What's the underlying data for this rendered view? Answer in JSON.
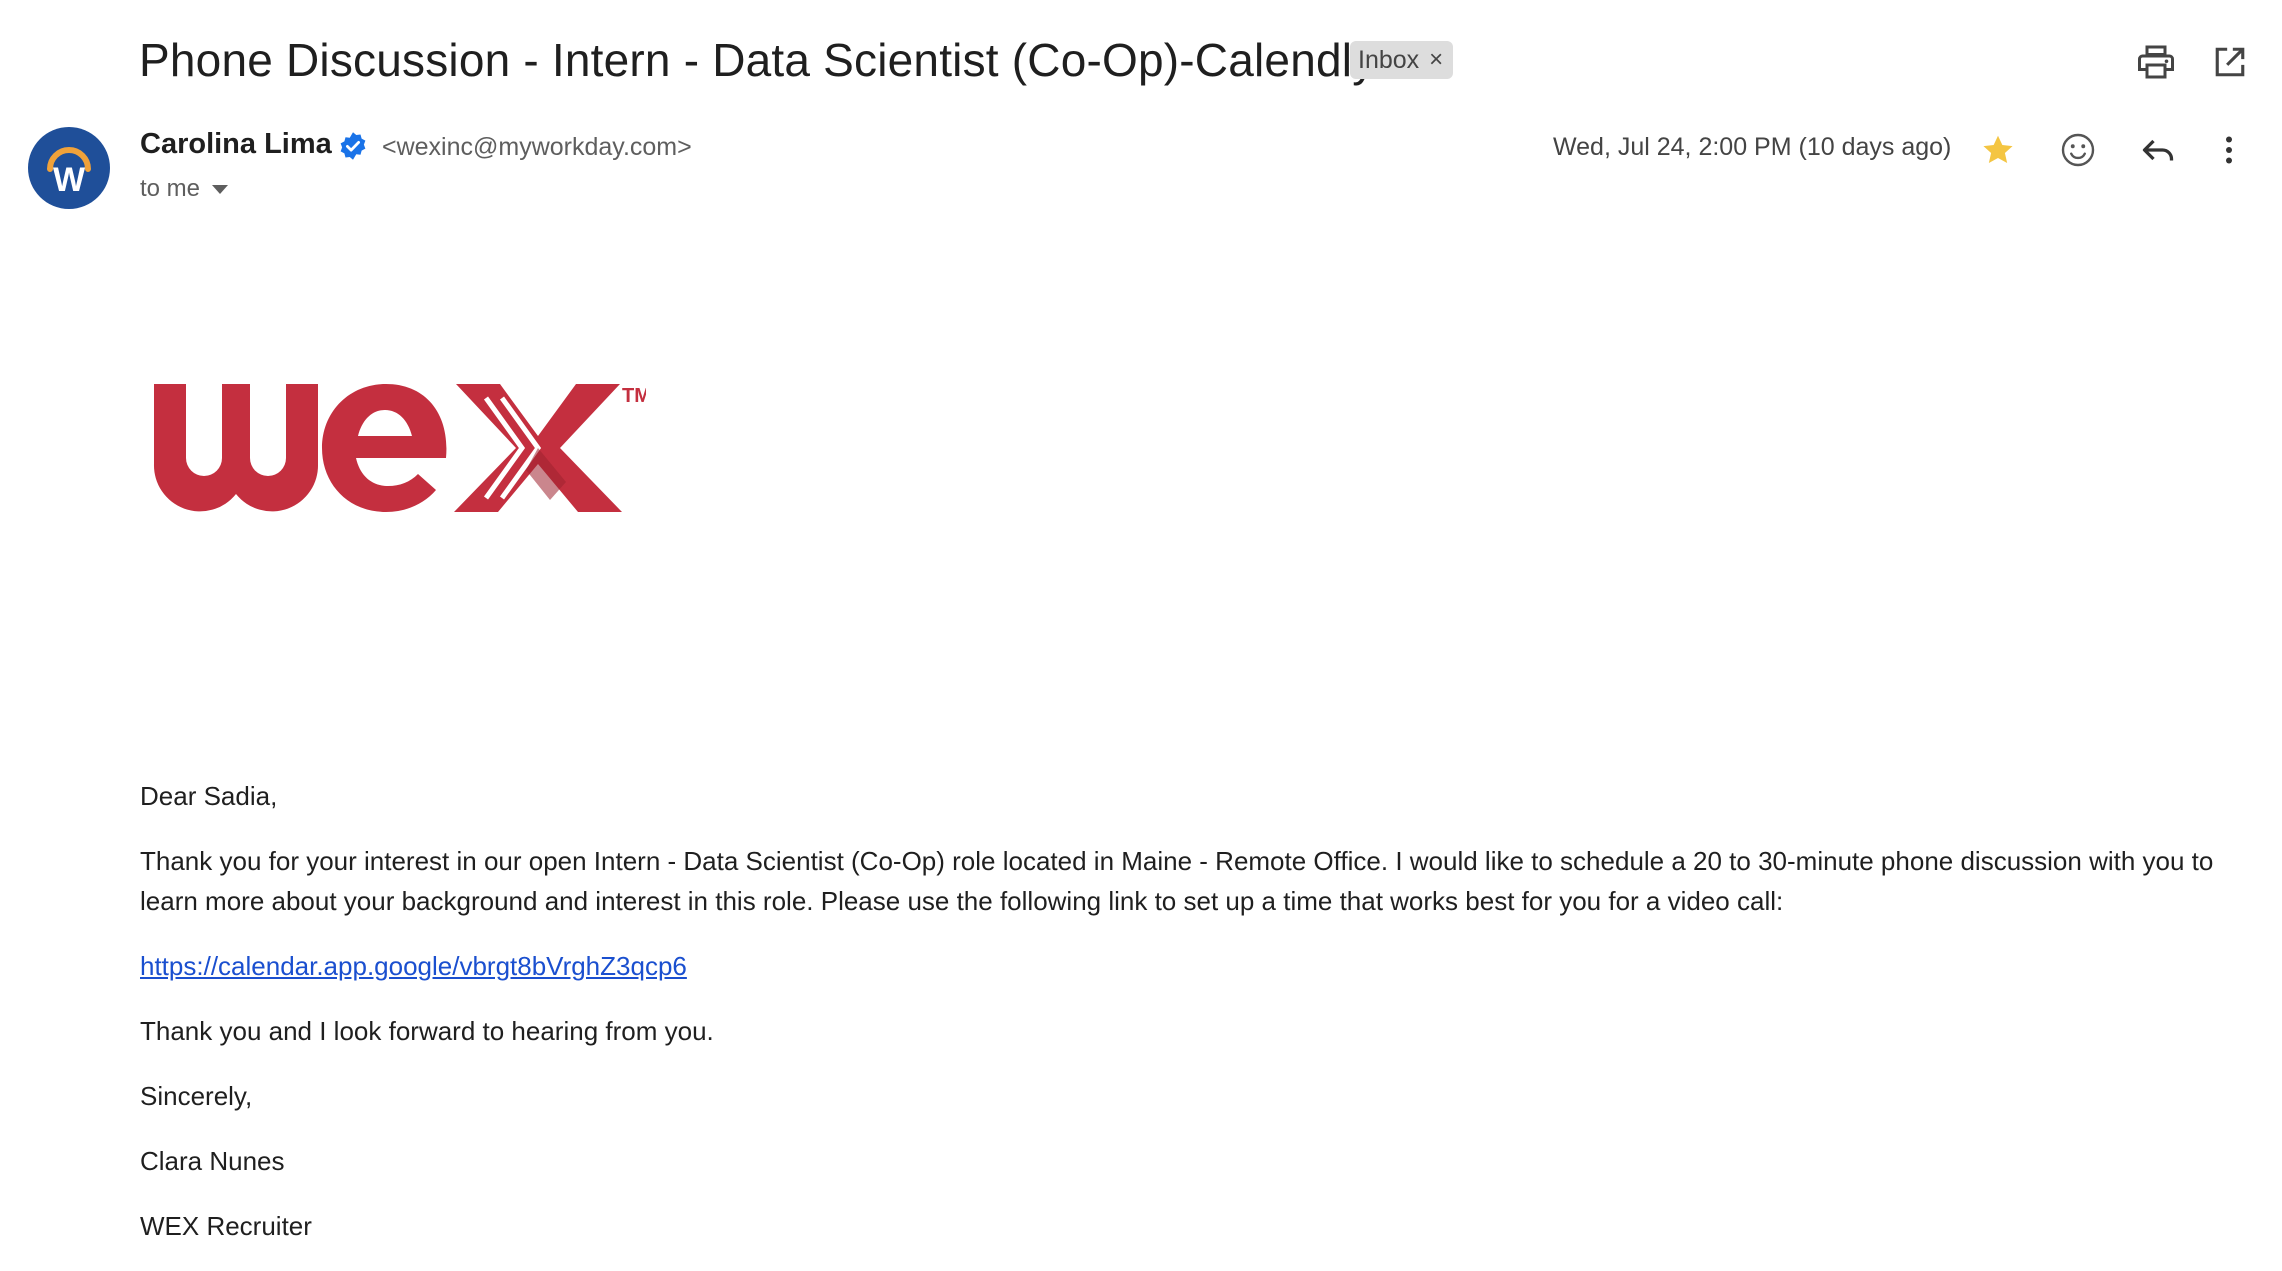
{
  "email": {
    "subject": "Phone Discussion - Intern - Data Scientist (Co-Op)-Calendly",
    "label_chip": "Inbox",
    "label_chip_remove": "×",
    "sender_name": "Carolina Lima",
    "sender_email": "<wexinc@myworkday.com>",
    "recipient": "to me",
    "date": "Wed, Jul 24, 2:00 PM (10 days ago)",
    "starred": true,
    "avatar_letter": "W",
    "logo_text": "wex",
    "logo_trademark": "TM"
  },
  "body": {
    "greeting": "Dear Sadia,",
    "paragraph1": "Thank you for your interest in our open Intern - Data Scientist (Co-Op) role located in Maine - Remote Office. I would like to schedule a 20 to 30-minute phone discussion with you to learn more about your background and interest in this role. Please use the following link to set up a time that works best for you for a video call:",
    "link": "https://calendar.app.google/vbrgt8bVrghZ3qcp6",
    "paragraph2": "Thank you and I look forward to hearing from you.",
    "closing": "Sincerely,",
    "signature_name": "Clara Nunes",
    "signature_title": "WEX Recruiter"
  },
  "colors": {
    "logo_red": "#c42f3f",
    "link_blue": "#1a4fcf",
    "star_yellow": "#f4c542",
    "avatar_blue": "#1f4f99",
    "avatar_arc_orange": "#f0a23a",
    "verified_blue": "#1a73e8"
  },
  "icons": [
    "print-icon",
    "open-in-new-window-icon",
    "verified-badge-icon",
    "chevron-down-icon",
    "star-icon",
    "emoji-reaction-icon",
    "reply-icon",
    "more-vert-icon"
  ]
}
